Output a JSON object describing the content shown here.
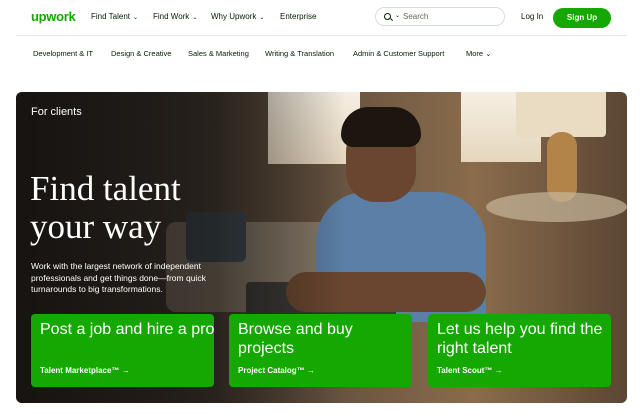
{
  "header": {
    "logo": "upwork",
    "nav": [
      {
        "label": "Find Talent",
        "chevron": "⌄"
      },
      {
        "label": "Find Work",
        "chevron": "⌄"
      },
      {
        "label": "Why Upwork",
        "chevron": "⌄"
      },
      {
        "label": "Enterprise",
        "chevron": ""
      }
    ],
    "search": {
      "placeholder": "Search"
    },
    "login": "Log In",
    "signup": "Sign Up"
  },
  "categories": [
    "Development & IT",
    "Design & Creative",
    "Sales & Marketing",
    "Writing & Translation",
    "Admin & Customer Support",
    "More"
  ],
  "hero": {
    "eyebrow": "For clients",
    "title_line1": "Find talent",
    "title_line2": "your way",
    "description": "Work with the largest network of independent professionals and get things done—from quick turnarounds to big transformations.",
    "cards": [
      {
        "title": "Post a job and hire a pro",
        "link": "Talent Marketplace™ →"
      },
      {
        "title": "Browse and buy projects",
        "link": "Project Catalog™ →"
      },
      {
        "title": "Let us help you find the right talent",
        "link": "Talent Scout™ →"
      }
    ]
  },
  "colors": {
    "brand": "#14a800",
    "text": "#001e00"
  }
}
